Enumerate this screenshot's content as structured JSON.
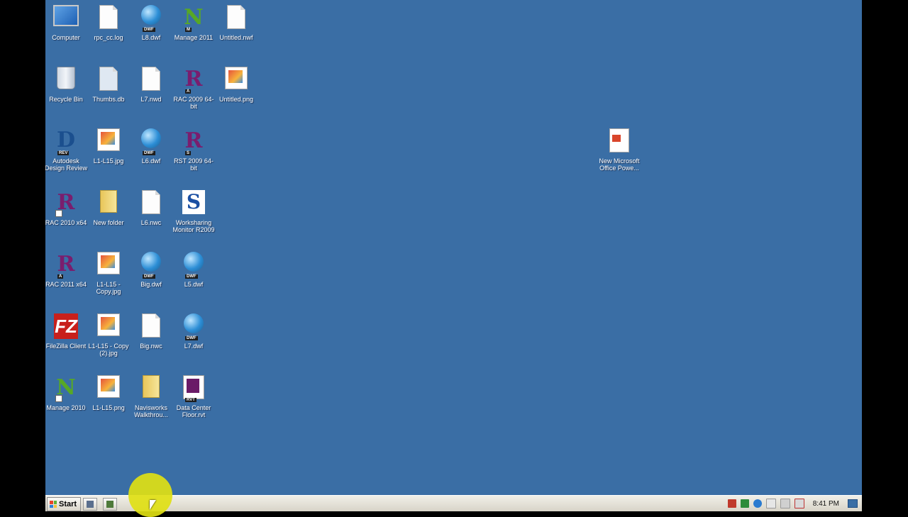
{
  "desktop": {
    "background_color": "#3a6ea5",
    "icons": [
      {
        "label": "Computer",
        "icon": "computer-icon"
      },
      {
        "label": "rpc_cc.log",
        "icon": "text-file-icon"
      },
      {
        "label": "L8.dwf",
        "icon": "dwf-file-icon"
      },
      {
        "label": "Manage 2011",
        "icon": "navisworks-manage-icon"
      },
      {
        "label": "Untitled.nwf",
        "icon": "nwf-file-icon"
      },
      {
        "label": "Recycle Bin",
        "icon": "recycle-bin-icon"
      },
      {
        "label": "Thumbs.db",
        "icon": "db-file-icon"
      },
      {
        "label": "L7.nwd",
        "icon": "nwd-file-icon"
      },
      {
        "label": "RAC 2009 64-bit",
        "icon": "revit-architecture-icon"
      },
      {
        "label": "Untitled.png",
        "icon": "image-file-icon"
      },
      {
        "label": "Autodesk Design Review",
        "icon": "design-review-icon"
      },
      {
        "label": "L1-L15.jpg",
        "icon": "image-file-icon"
      },
      {
        "label": "L6.dwf",
        "icon": "dwf-file-icon"
      },
      {
        "label": "RST 2009 64-bit",
        "icon": "revit-structure-icon"
      },
      {
        "label": "RAC 2010 x64",
        "icon": "revit-architecture-icon"
      },
      {
        "label": "New folder",
        "icon": "folder-icon"
      },
      {
        "label": "L6.nwc",
        "icon": "nwc-file-icon"
      },
      {
        "label": "Worksharing Monitor R2009",
        "icon": "worksharing-monitor-icon"
      },
      {
        "label": "RAC 2011 x64",
        "icon": "revit-architecture-icon"
      },
      {
        "label": "L1-L15 - Copy.jpg",
        "icon": "image-file-icon"
      },
      {
        "label": "Big.dwf",
        "icon": "dwf-file-icon"
      },
      {
        "label": "L5.dwf",
        "icon": "dwf-file-icon"
      },
      {
        "label": "FileZilla Client",
        "icon": "filezilla-icon"
      },
      {
        "label": "L1-L15 - Copy (2).jpg",
        "icon": "image-file-icon"
      },
      {
        "label": "Big.nwc",
        "icon": "nwc-file-icon"
      },
      {
        "label": "L7.dwf",
        "icon": "dwf-file-icon"
      },
      {
        "label": "Manage 2010",
        "icon": "navisworks-manage-icon"
      },
      {
        "label": "L1-L15.png",
        "icon": "image-file-icon"
      },
      {
        "label": "Navisworks Walkthrou...",
        "icon": "folder-icon"
      },
      {
        "label": "Data Center Floor.rvt",
        "icon": "rvt-file-icon"
      },
      {
        "label": "New Microsoft Office Powe...",
        "icon": "powerpoint-file-icon"
      }
    ]
  },
  "taskbar": {
    "start_label": "Start",
    "quick_launch": [
      "show-desktop-icon",
      "app-launch-icon"
    ],
    "tray_icons": [
      "red-app-icon",
      "green-app-icon",
      "network-icon",
      "flag-icon",
      "sync-icon",
      "volume-muted-icon"
    ],
    "clock": "8:41 PM"
  }
}
